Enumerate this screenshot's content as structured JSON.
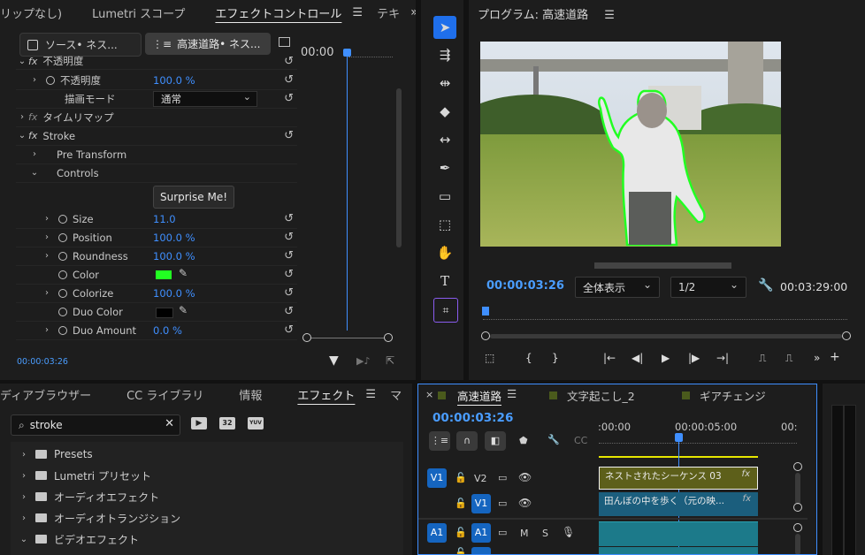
{
  "top_left": {
    "tabs": [
      "リップなし)",
      "Lumetri スコープ",
      "エフェクトコントロール",
      "テキ"
    ],
    "source_tab": "ソース• ネス...",
    "clip_tab": "高速道路• ネス...",
    "timecode_ruler": "00:00",
    "rows": [
      {
        "label": "不透明度",
        "value": ""
      },
      {
        "label": "不透明度",
        "value": "100.0 %"
      },
      {
        "label": "描画モード",
        "value": "通常"
      },
      {
        "label": "タイムリマップ",
        "value": ""
      },
      {
        "label": "Stroke",
        "value": ""
      },
      {
        "label": "Pre Transform",
        "value": ""
      },
      {
        "label": "Controls",
        "value": ""
      },
      {
        "label": "Size",
        "value": "11.0"
      },
      {
        "label": "Position",
        "value": "100.0 %"
      },
      {
        "label": "Roundness",
        "value": "100.0 %"
      },
      {
        "label": "Color",
        "value": ""
      },
      {
        "label": "Colorize",
        "value": "100.0 %"
      },
      {
        "label": "Duo Color",
        "value": ""
      },
      {
        "label": "Duo Amount",
        "value": "0.0 %"
      }
    ],
    "surprise_button": "Surprise Me!",
    "current_time": "00:00:03:26",
    "colors": {
      "stroke_color": "#22ff22",
      "duo_color": "#000000"
    }
  },
  "program": {
    "title": "プログラム: 高速道路",
    "timecode": "00:00:03:26",
    "zoom": "全体表示",
    "resolution": "1/2",
    "duration": "00:03:29:00"
  },
  "effects_panel": {
    "tabs": [
      "ディアブラウザー",
      "CC ライブラリ",
      "情報",
      "エフェクト",
      "マ"
    ],
    "search_value": "stroke",
    "icons": [
      "32",
      "YUV"
    ],
    "items": [
      "Presets",
      "Lumetri プリセット",
      "オーディオエフェクト",
      "オーディオトランジション",
      "ビデオエフェクト"
    ]
  },
  "timeline": {
    "tabs": [
      "高速道路",
      "文字起こし_2",
      "ギアチェンジ"
    ],
    "timecode": "00:00:03:26",
    "ruler": [
      ":00:00",
      "00:00:05:00",
      "00:"
    ],
    "tracks": [
      {
        "toggle": "V1",
        "name": "V2"
      },
      {
        "toggle": "",
        "name": "V1"
      },
      {
        "toggle": "A1",
        "name": "A1"
      }
    ],
    "track_buttons": [
      "M",
      "S"
    ],
    "clips": [
      {
        "label": "ネストされたシーケンス 03",
        "fx": "fx"
      },
      {
        "label": "田んぼの中を歩く（元の映...",
        "fx": "fx"
      }
    ]
  }
}
